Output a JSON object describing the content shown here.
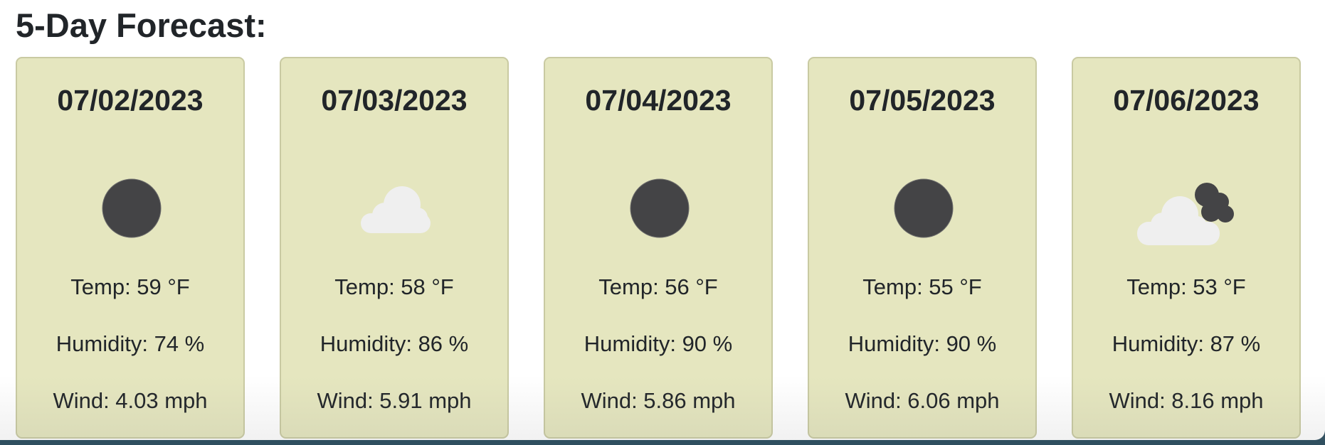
{
  "forecast": {
    "title": "5-Day Forecast:",
    "days": [
      {
        "date": "07/02/2023",
        "icon": "dark-circle-icon",
        "temp": "Temp: 59 °F",
        "humidity": "Humidity: 74 %",
        "wind": "Wind: 4.03 mph"
      },
      {
        "date": "07/03/2023",
        "icon": "cloud-icon",
        "temp": "Temp: 58 °F",
        "humidity": "Humidity: 86 %",
        "wind": "Wind: 5.91 mph"
      },
      {
        "date": "07/04/2023",
        "icon": "dark-circle-icon",
        "temp": "Temp: 56 °F",
        "humidity": "Humidity: 90 %",
        "wind": "Wind: 5.86 mph"
      },
      {
        "date": "07/05/2023",
        "icon": "dark-circle-icon",
        "temp": "Temp: 55 °F",
        "humidity": "Humidity: 90 %",
        "wind": "Wind: 6.06 mph"
      },
      {
        "date": "07/06/2023",
        "icon": "dark-cloud-light-cloud-icon",
        "temp": "Temp: 53 °F",
        "humidity": "Humidity: 87 %",
        "wind": "Wind: 8.16 mph"
      }
    ]
  },
  "colors": {
    "card_background": "#e5e6bf",
    "card_border": "#c9caa2",
    "text": "#212529",
    "icon_dark": "#444446",
    "icon_light": "#efefef"
  }
}
